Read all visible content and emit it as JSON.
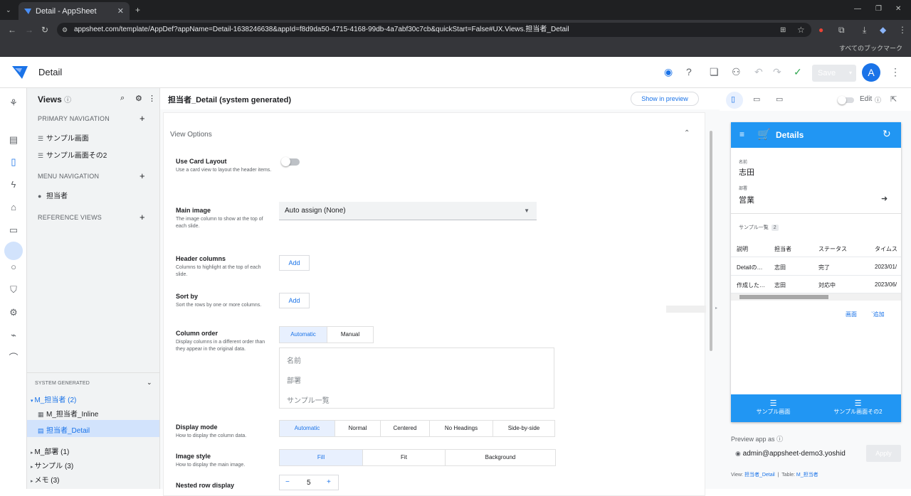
{
  "browser": {
    "tab_title": "Detail - AppSheet",
    "url": "appsheet.com/template/AppDef?appName=Detail-1638246638&appId=f8d9da50-4715-4168-99db-4a7abf30c7cb&quickStart=False#UX.Views.担当者_Detail",
    "bookmarks_label": "すべてのブックマーク"
  },
  "app": {
    "title": "Detail",
    "save_label": "Save",
    "avatar_letter": "A"
  },
  "views_panel": {
    "title": "Views",
    "primary_nav_label": "PRIMARY NAVIGATION",
    "primary_items": [
      "サンプル画面",
      "サンプル画面その2"
    ],
    "menu_nav_label": "MENU NAVIGATION",
    "menu_items": [
      "担当者"
    ],
    "reference_label": "REFERENCE VIEWS",
    "system_generated_label": "SYSTEM GENERATED",
    "sys_groups": [
      {
        "label": "M_担当者 (2)",
        "children": [
          "M_担当者_Inline",
          "担当者_Detail"
        ]
      },
      {
        "label": "M_部署 (1)"
      },
      {
        "label": "サンプル (3)"
      },
      {
        "label": "メモ (3)"
      }
    ]
  },
  "editor": {
    "title": "担当者_Detail (system generated)",
    "show_in_preview": "Show in preview",
    "section": "View Options",
    "use_card": {
      "label": "Use Card Layout",
      "help": "Use a card view to layout the header items."
    },
    "main_image": {
      "label": "Main image",
      "help": "The image column to show at the top of each slide.",
      "value": "Auto assign (None)"
    },
    "header_columns": {
      "label": "Header columns",
      "help": "Columns to highlight at the top of each slide.",
      "button": "Add"
    },
    "sort_by": {
      "label": "Sort by",
      "help": "Sort the rows by one or more columns.",
      "button": "Add"
    },
    "column_order": {
      "label": "Column order",
      "help": "Display columns in a different order than they appear in the original data.",
      "options": [
        "Automatic",
        "Manual"
      ],
      "columns": [
        "名前",
        "部署",
        "サンプル一覧"
      ]
    },
    "display_mode": {
      "label": "Display mode",
      "help": "How to display the column data.",
      "options": [
        "Automatic",
        "Normal",
        "Centered",
        "No Headings",
        "Side-by-side"
      ]
    },
    "image_style": {
      "label": "Image style",
      "help": "How to display the main image.",
      "options": [
        "Fill",
        "Fit",
        "Background"
      ]
    },
    "nested_row": {
      "label": "Nested row display",
      "minus": "−",
      "value": "5",
      "plus": "+"
    }
  },
  "preview": {
    "edit_label": "Edit",
    "phone_title": "Details",
    "fields": [
      {
        "key": "名前",
        "value": "志田"
      },
      {
        "key": "部署",
        "value": "営業"
      }
    ],
    "sample_label": "サンプル一覧",
    "sample_count": "2",
    "table_headers": [
      "説明",
      "担当者",
      "ステータス",
      "タイムス"
    ],
    "table_rows": [
      [
        "Detailの…",
        "志田",
        "完了",
        "2023/01/"
      ],
      [
        "作成した…",
        "志田",
        "対応中",
        "2023/06/"
      ]
    ],
    "link_view": "画面",
    "link_add": "追加",
    "nav_items": [
      "サンプル画面",
      "サンプル画面その2"
    ],
    "preview_as_label": "Preview app as",
    "user_email": "admin@appsheet-demo3.yoshid",
    "apply_label": "Apply",
    "footer_view_label": "View:",
    "footer_view": "担当者_Detail",
    "footer_table_label": "Table:",
    "footer_table": "M_担当者"
  },
  "colors": {
    "accent": "#1a73e8",
    "phone_header": "#2196f3",
    "selected_bg": "#d2e3fc"
  }
}
